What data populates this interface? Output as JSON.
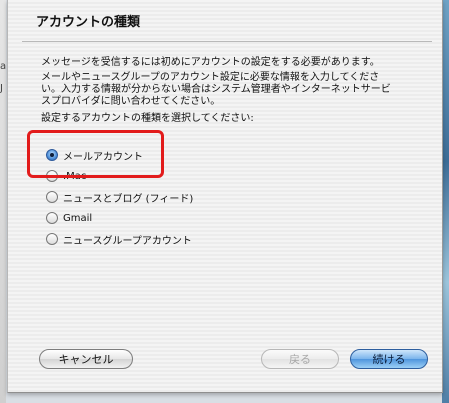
{
  "dialog": {
    "title": "アカウントの種類"
  },
  "intro": {
    "line1": "メッセージを受信するには初めにアカウントの設定をする必要があります。",
    "line2": "メールやニュースグループのアカウント設定に必要な情報を入力してくださ",
    "line3": "い。入力する情報が分からない場合はシステム管理者やインターネットサービ",
    "line4": "スプロバイダに問い合わせてください。",
    "prompt": "設定するアカウントの種類を選択してください:"
  },
  "account_types": {
    "mail": {
      "label": "メールアカウント",
      "selected": true
    },
    "mac": {
      "label": ".Mac",
      "selected": false
    },
    "news_blog": {
      "label": "ニュースとブログ (フィード)",
      "selected": false
    },
    "gmail": {
      "label": "Gmail",
      "selected": false
    },
    "newsgroup": {
      "label": "ニュースグループアカウント",
      "selected": false
    }
  },
  "buttons": {
    "cancel": "キャンセル",
    "back": "戻る",
    "continue": "続ける"
  },
  "annotation": {
    "highlight_color": "#e21b1b"
  }
}
